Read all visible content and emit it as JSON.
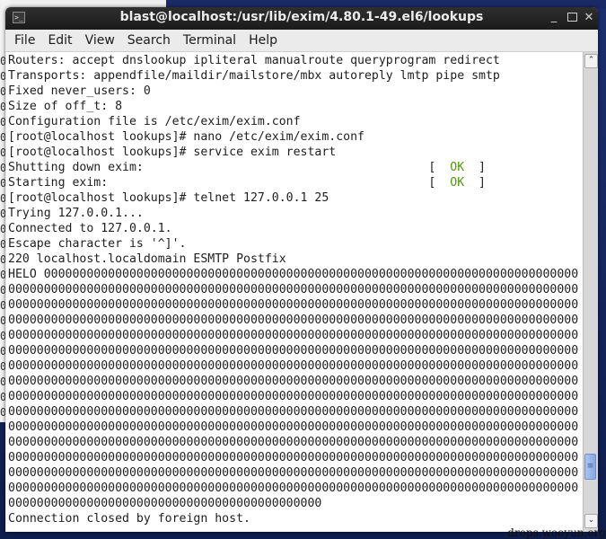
{
  "window": {
    "title": "blast@localhost:/usr/lib/exim/4.80.1-49.el6/lookups",
    "icon": "terminal-icon",
    "controls": {
      "minimize": "_",
      "maximize": "",
      "close": "✕"
    }
  },
  "menubar": {
    "items": [
      "File",
      "Edit",
      "View",
      "Search",
      "Terminal",
      "Help"
    ]
  },
  "terminal": {
    "lines": [
      "Routers: accept dnslookup ipliteral manualroute queryprogram redirect",
      "Transports: appendfile/maildir/mailstore/mbx autoreply lmtp pipe smtp",
      "Fixed never_users: 0",
      "Size of off_t: 8",
      "Configuration file is /etc/exim/exim.conf",
      "[root@localhost lookups]# nano /etc/exim/exim.conf",
      "[root@localhost lookups]# service exim restart"
    ],
    "service_status": [
      {
        "label": "Shutting down exim:",
        "status": "OK"
      },
      {
        "label": "Starting exim:",
        "status": "OK"
      }
    ],
    "lines_after": [
      "[root@localhost lookups]# telnet 127.0.0.1 25",
      "Trying 127.0.0.1...",
      "Connected to 127.0.0.1.",
      "Escape character is '^]'.",
      "220 localhost.localdomain ESMTP Postfix"
    ],
    "helo": {
      "command": "HELO",
      "fill_char": "0",
      "first_line_zeros": 75,
      "full_lines": 14,
      "full_line_zeros": 80,
      "last_line_zeros": 44
    },
    "final_line": "Connection closed by foreign host.",
    "ok_color": "#4e9a06"
  },
  "scrollbar": {
    "up_icon": "^",
    "down_icon": "v",
    "thumb_icon": "≡",
    "position_fraction": 0.9
  },
  "watermark": "drops.wooyun.org"
}
